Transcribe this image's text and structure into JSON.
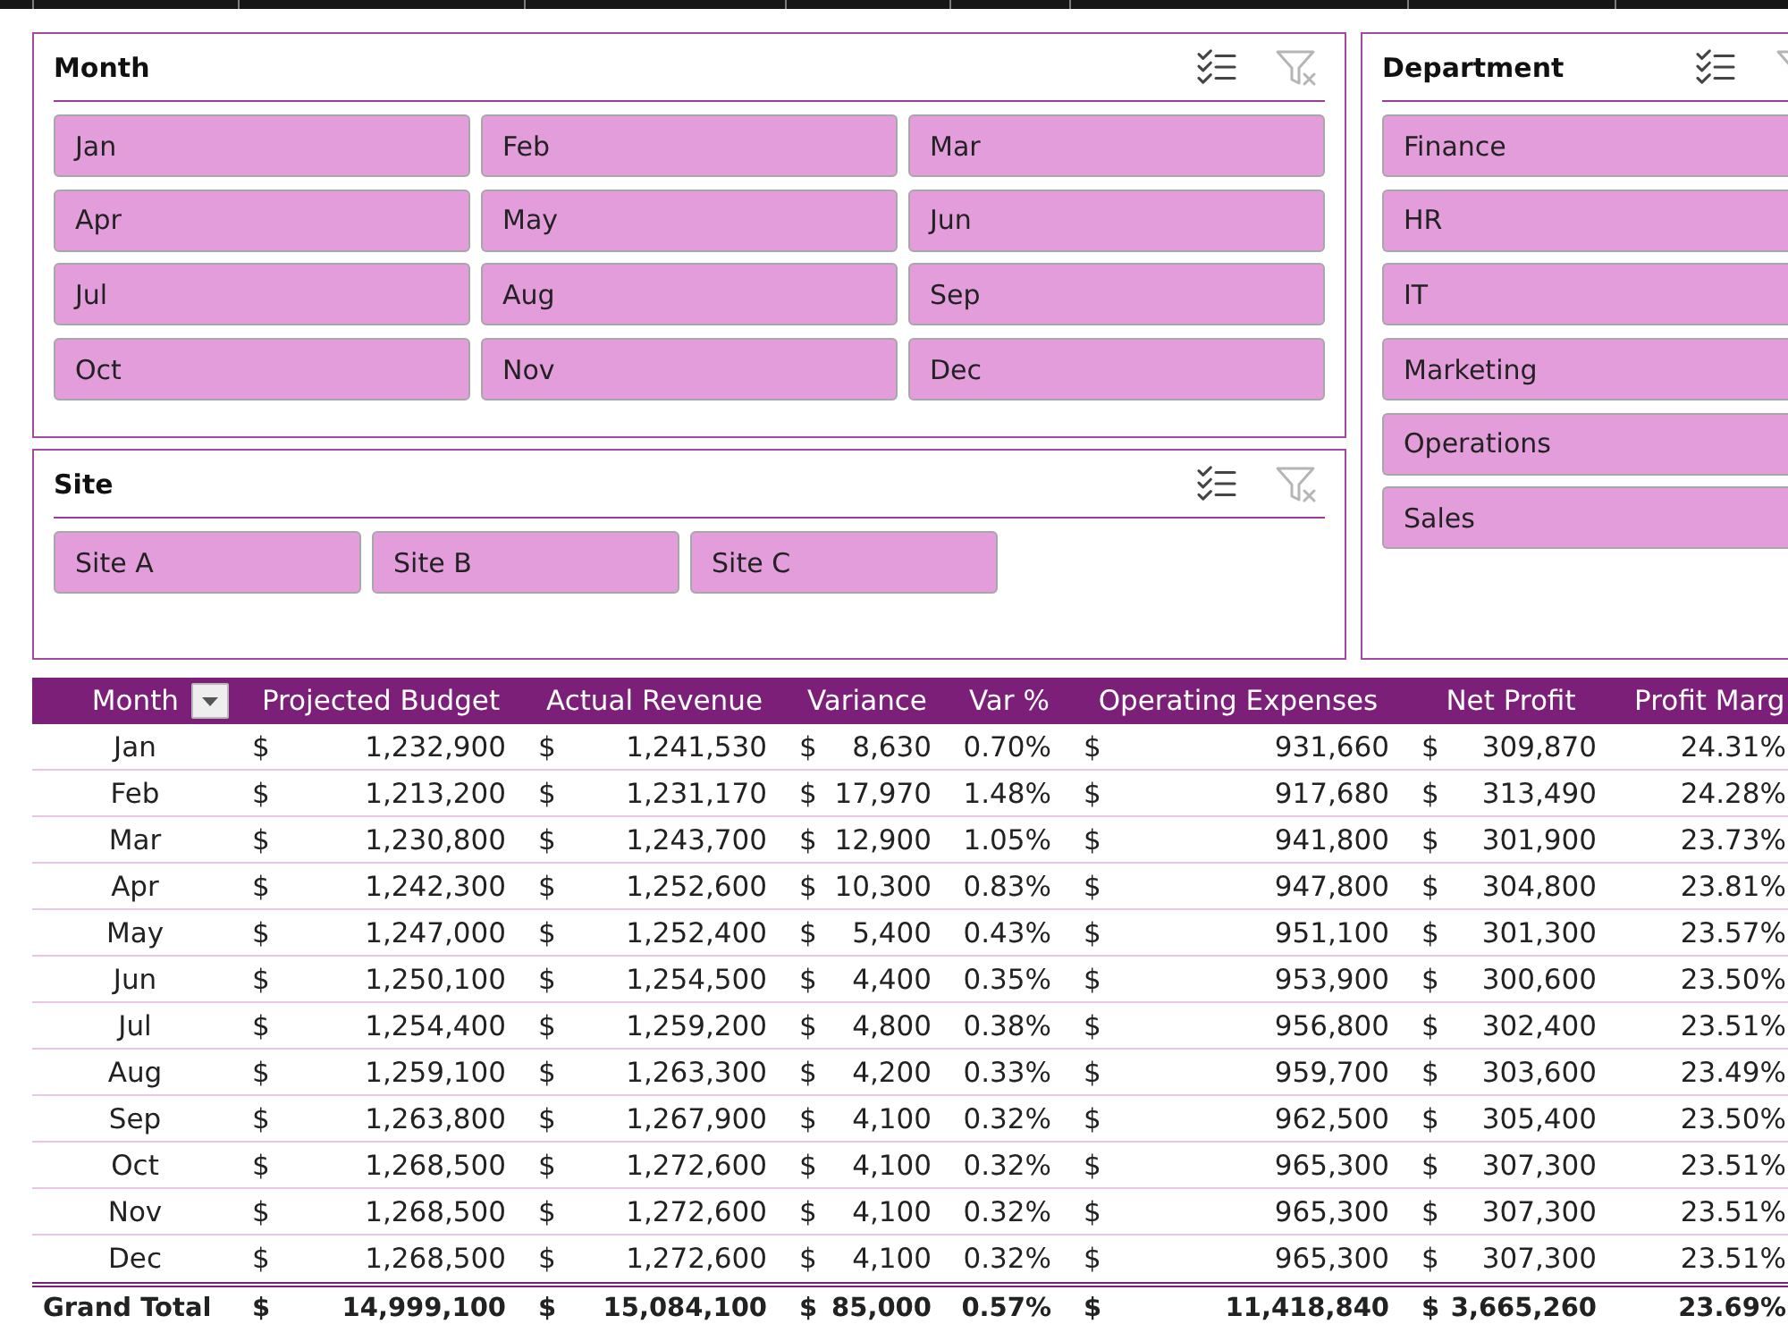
{
  "month_slicer": {
    "title": "Month",
    "clear_filter_disabled": true,
    "items": [
      {
        "label": "Jan",
        "selected": true
      },
      {
        "label": "Feb",
        "selected": true
      },
      {
        "label": "Mar",
        "selected": true
      },
      {
        "label": "Apr",
        "selected": true
      },
      {
        "label": "May",
        "selected": true
      },
      {
        "label": "Jun",
        "selected": true
      },
      {
        "label": "Jul",
        "selected": true
      },
      {
        "label": "Aug",
        "selected": true
      },
      {
        "label": "Sep",
        "selected": true
      },
      {
        "label": "Oct",
        "selected": true
      },
      {
        "label": "Nov",
        "selected": true
      },
      {
        "label": "Dec",
        "selected": true
      }
    ]
  },
  "department_slicer": {
    "title": "Department",
    "clear_filter_disabled": true,
    "items": [
      {
        "label": "Finance",
        "selected": true
      },
      {
        "label": "HR",
        "selected": true
      },
      {
        "label": "IT",
        "selected": true
      },
      {
        "label": "Marketing",
        "selected": true
      },
      {
        "label": "Operations",
        "selected": true
      },
      {
        "label": "Sales",
        "selected": true
      }
    ]
  },
  "site_slicer": {
    "title": "Site",
    "clear_filter_disabled": true,
    "items": [
      {
        "label": "Site A",
        "selected": true
      },
      {
        "label": "Site B",
        "selected": true
      },
      {
        "label": "Site C",
        "selected": true
      }
    ]
  },
  "table": {
    "columns": [
      {
        "label": "Month",
        "kind": "text",
        "filter_button": true
      },
      {
        "label": "Projected Budget",
        "kind": "accounting",
        "filter_button": false
      },
      {
        "label": "Actual Revenue",
        "kind": "accounting",
        "filter_button": false
      },
      {
        "label": "Variance",
        "kind": "accounting",
        "filter_button": false
      },
      {
        "label": "Var %",
        "kind": "percent",
        "filter_button": false
      },
      {
        "label": "Operating Expenses",
        "kind": "accounting",
        "filter_button": false
      },
      {
        "label": "Net Profit",
        "kind": "accounting",
        "filter_button": false
      },
      {
        "label": "Profit Marg",
        "kind": "percent",
        "filter_button": false
      }
    ],
    "rows": [
      {
        "cells": [
          {
            "text": "Jan"
          },
          {
            "symbol": "$",
            "amount": "1,232,900"
          },
          {
            "symbol": "$",
            "amount": "1,241,530"
          },
          {
            "symbol": "$",
            "amount": "8,630"
          },
          {
            "text": "0.70%"
          },
          {
            "symbol": "$",
            "amount": "931,660"
          },
          {
            "symbol": "$",
            "amount": "309,870"
          },
          {
            "text": "24.31%"
          }
        ]
      },
      {
        "cells": [
          {
            "text": "Feb"
          },
          {
            "symbol": "$",
            "amount": "1,213,200"
          },
          {
            "symbol": "$",
            "amount": "1,231,170"
          },
          {
            "symbol": "$",
            "amount": "17,970"
          },
          {
            "text": "1.48%"
          },
          {
            "symbol": "$",
            "amount": "917,680"
          },
          {
            "symbol": "$",
            "amount": "313,490"
          },
          {
            "text": "24.28%"
          }
        ]
      },
      {
        "cells": [
          {
            "text": "Mar"
          },
          {
            "symbol": "$",
            "amount": "1,230,800"
          },
          {
            "symbol": "$",
            "amount": "1,243,700"
          },
          {
            "symbol": "$",
            "amount": "12,900"
          },
          {
            "text": "1.05%"
          },
          {
            "symbol": "$",
            "amount": "941,800"
          },
          {
            "symbol": "$",
            "amount": "301,900"
          },
          {
            "text": "23.73%"
          }
        ]
      },
      {
        "cells": [
          {
            "text": "Apr"
          },
          {
            "symbol": "$",
            "amount": "1,242,300"
          },
          {
            "symbol": "$",
            "amount": "1,252,600"
          },
          {
            "symbol": "$",
            "amount": "10,300"
          },
          {
            "text": "0.83%"
          },
          {
            "symbol": "$",
            "amount": "947,800"
          },
          {
            "symbol": "$",
            "amount": "304,800"
          },
          {
            "text": "23.81%"
          }
        ]
      },
      {
        "cells": [
          {
            "text": "May"
          },
          {
            "symbol": "$",
            "amount": "1,247,000"
          },
          {
            "symbol": "$",
            "amount": "1,252,400"
          },
          {
            "symbol": "$",
            "amount": "5,400"
          },
          {
            "text": "0.43%"
          },
          {
            "symbol": "$",
            "amount": "951,100"
          },
          {
            "symbol": "$",
            "amount": "301,300"
          },
          {
            "text": "23.57%"
          }
        ]
      },
      {
        "cells": [
          {
            "text": "Jun"
          },
          {
            "symbol": "$",
            "amount": "1,250,100"
          },
          {
            "symbol": "$",
            "amount": "1,254,500"
          },
          {
            "symbol": "$",
            "amount": "4,400"
          },
          {
            "text": "0.35%"
          },
          {
            "symbol": "$",
            "amount": "953,900"
          },
          {
            "symbol": "$",
            "amount": "300,600"
          },
          {
            "text": "23.50%"
          }
        ]
      },
      {
        "cells": [
          {
            "text": "Jul"
          },
          {
            "symbol": "$",
            "amount": "1,254,400"
          },
          {
            "symbol": "$",
            "amount": "1,259,200"
          },
          {
            "symbol": "$",
            "amount": "4,800"
          },
          {
            "text": "0.38%"
          },
          {
            "symbol": "$",
            "amount": "956,800"
          },
          {
            "symbol": "$",
            "amount": "302,400"
          },
          {
            "text": "23.51%"
          }
        ]
      },
      {
        "cells": [
          {
            "text": "Aug"
          },
          {
            "symbol": "$",
            "amount": "1,259,100"
          },
          {
            "symbol": "$",
            "amount": "1,263,300"
          },
          {
            "symbol": "$",
            "amount": "4,200"
          },
          {
            "text": "0.33%"
          },
          {
            "symbol": "$",
            "amount": "959,700"
          },
          {
            "symbol": "$",
            "amount": "303,600"
          },
          {
            "text": "23.49%"
          }
        ]
      },
      {
        "cells": [
          {
            "text": "Sep"
          },
          {
            "symbol": "$",
            "amount": "1,263,800"
          },
          {
            "symbol": "$",
            "amount": "1,267,900"
          },
          {
            "symbol": "$",
            "amount": "4,100"
          },
          {
            "text": "0.32%"
          },
          {
            "symbol": "$",
            "amount": "962,500"
          },
          {
            "symbol": "$",
            "amount": "305,400"
          },
          {
            "text": "23.50%"
          }
        ]
      },
      {
        "cells": [
          {
            "text": "Oct"
          },
          {
            "symbol": "$",
            "amount": "1,268,500"
          },
          {
            "symbol": "$",
            "amount": "1,272,600"
          },
          {
            "symbol": "$",
            "amount": "4,100"
          },
          {
            "text": "0.32%"
          },
          {
            "symbol": "$",
            "amount": "965,300"
          },
          {
            "symbol": "$",
            "amount": "307,300"
          },
          {
            "text": "23.51%"
          }
        ]
      },
      {
        "cells": [
          {
            "text": "Nov"
          },
          {
            "symbol": "$",
            "amount": "1,268,500"
          },
          {
            "symbol": "$",
            "amount": "1,272,600"
          },
          {
            "symbol": "$",
            "amount": "4,100"
          },
          {
            "text": "0.32%"
          },
          {
            "symbol": "$",
            "amount": "965,300"
          },
          {
            "symbol": "$",
            "amount": "307,300"
          },
          {
            "text": "23.51%"
          }
        ]
      },
      {
        "cells": [
          {
            "text": "Dec"
          },
          {
            "symbol": "$",
            "amount": "1,268,500"
          },
          {
            "symbol": "$",
            "amount": "1,272,600"
          },
          {
            "symbol": "$",
            "amount": "4,100"
          },
          {
            "text": "0.32%"
          },
          {
            "symbol": "$",
            "amount": "965,300"
          },
          {
            "symbol": "$",
            "amount": "307,300"
          },
          {
            "text": "23.51%"
          }
        ]
      }
    ],
    "total_row": {
      "cells": [
        {
          "text": "Grand Total"
        },
        {
          "symbol": "$",
          "amount": "14,999,100"
        },
        {
          "symbol": "$",
          "amount": "15,084,100"
        },
        {
          "symbol": "$",
          "amount": "85,000"
        },
        {
          "text": "0.57%"
        },
        {
          "symbol": "$",
          "amount": "11,418,840"
        },
        {
          "symbol": "$",
          "amount": "3,665,260"
        },
        {
          "text": "23.69%"
        }
      ]
    }
  }
}
